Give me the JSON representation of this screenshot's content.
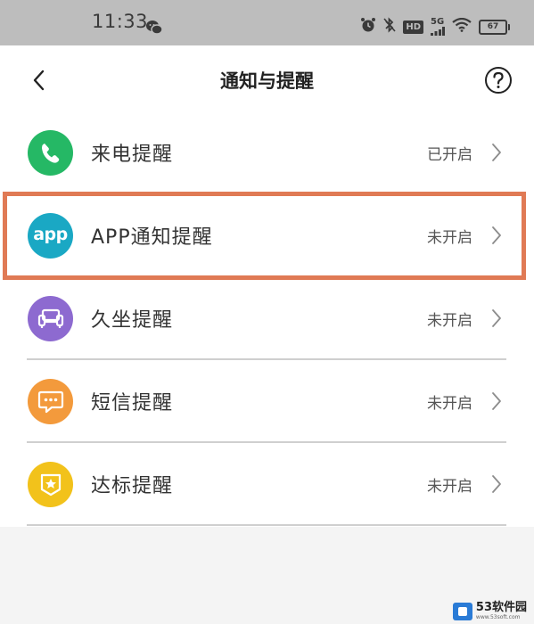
{
  "status_bar": {
    "time": "11:33",
    "hd_label": "HD",
    "signal_label": "5G",
    "battery_level": "67"
  },
  "header": {
    "title": "通知与提醒"
  },
  "rows": [
    {
      "label": "来电提醒",
      "status": "已开启",
      "icon": "phone-icon",
      "color": "#25b865"
    },
    {
      "label": "APP通知提醒",
      "status": "未开启",
      "icon": "app-icon",
      "icon_text": "app",
      "color": "#1aa8c4"
    },
    {
      "label": "久坐提醒",
      "status": "未开启",
      "icon": "sofa-icon",
      "color": "#8d6ad0"
    },
    {
      "label": "短信提醒",
      "status": "未开启",
      "icon": "message-icon",
      "color": "#f39a3c"
    },
    {
      "label": "达标提醒",
      "status": "未开启",
      "icon": "badge-star-icon",
      "color": "#f2c21b"
    }
  ],
  "highlight": {
    "color": "#e07a55",
    "target": "APP通知提醒"
  },
  "watermark": {
    "text": "53软件园",
    "sub": "www.53soft.com"
  }
}
